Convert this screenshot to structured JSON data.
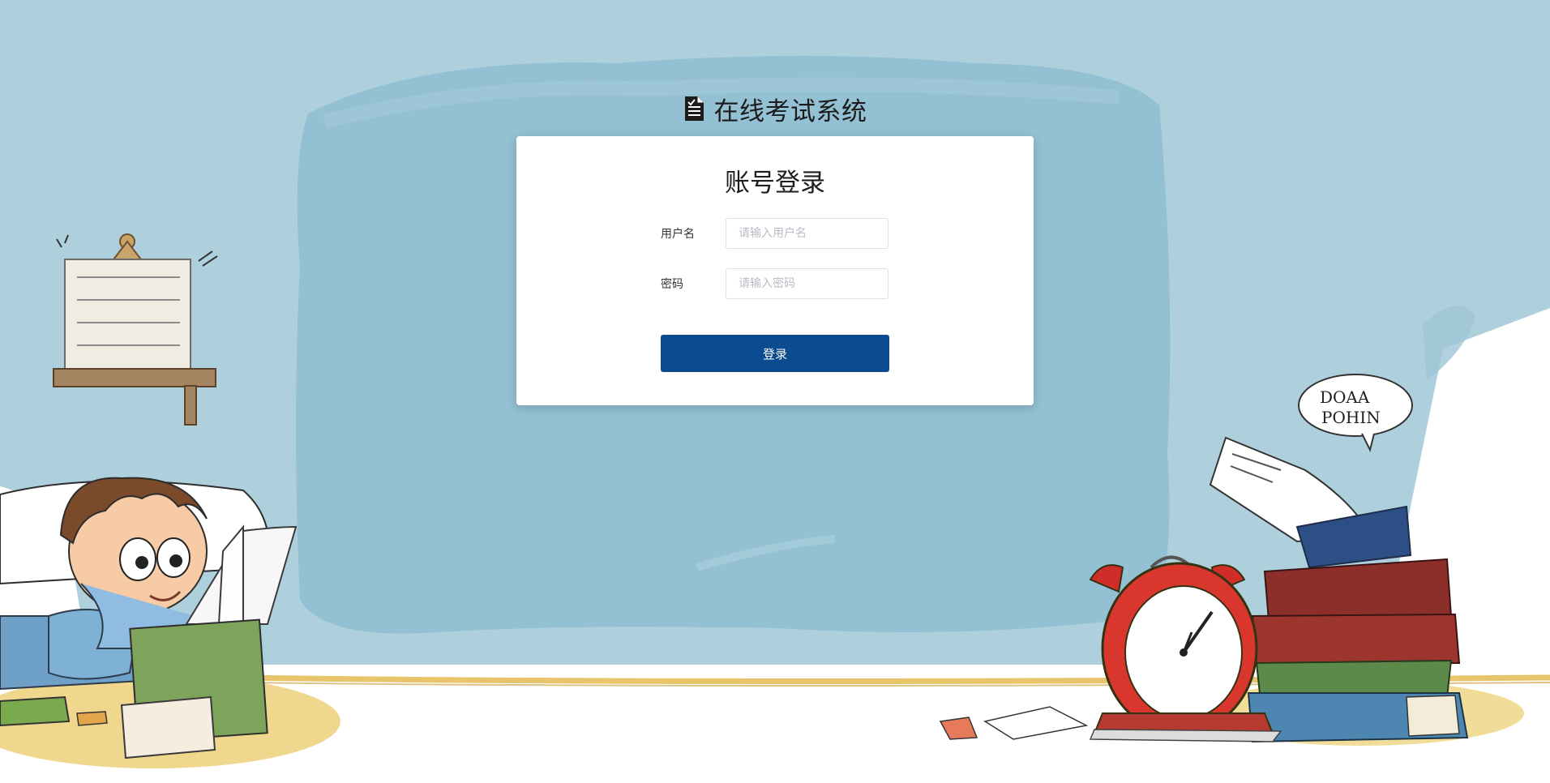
{
  "header": {
    "icon": "document-icon",
    "title": "在线考试系统"
  },
  "login_card": {
    "title": "账号登录",
    "username": {
      "label": "用户名",
      "placeholder": "请输入用户名",
      "value": ""
    },
    "password": {
      "label": "密码",
      "placeholder": "请输入密码",
      "value": ""
    },
    "submit_label": "登录"
  },
  "illustration": {
    "speech_bubble_text": [
      "DOAA",
      "POHIN"
    ]
  },
  "colors": {
    "background": "#aed0dc",
    "paint_blob": "#93c0d3",
    "primary_button": "#0b4b90",
    "card": "#ffffff"
  }
}
